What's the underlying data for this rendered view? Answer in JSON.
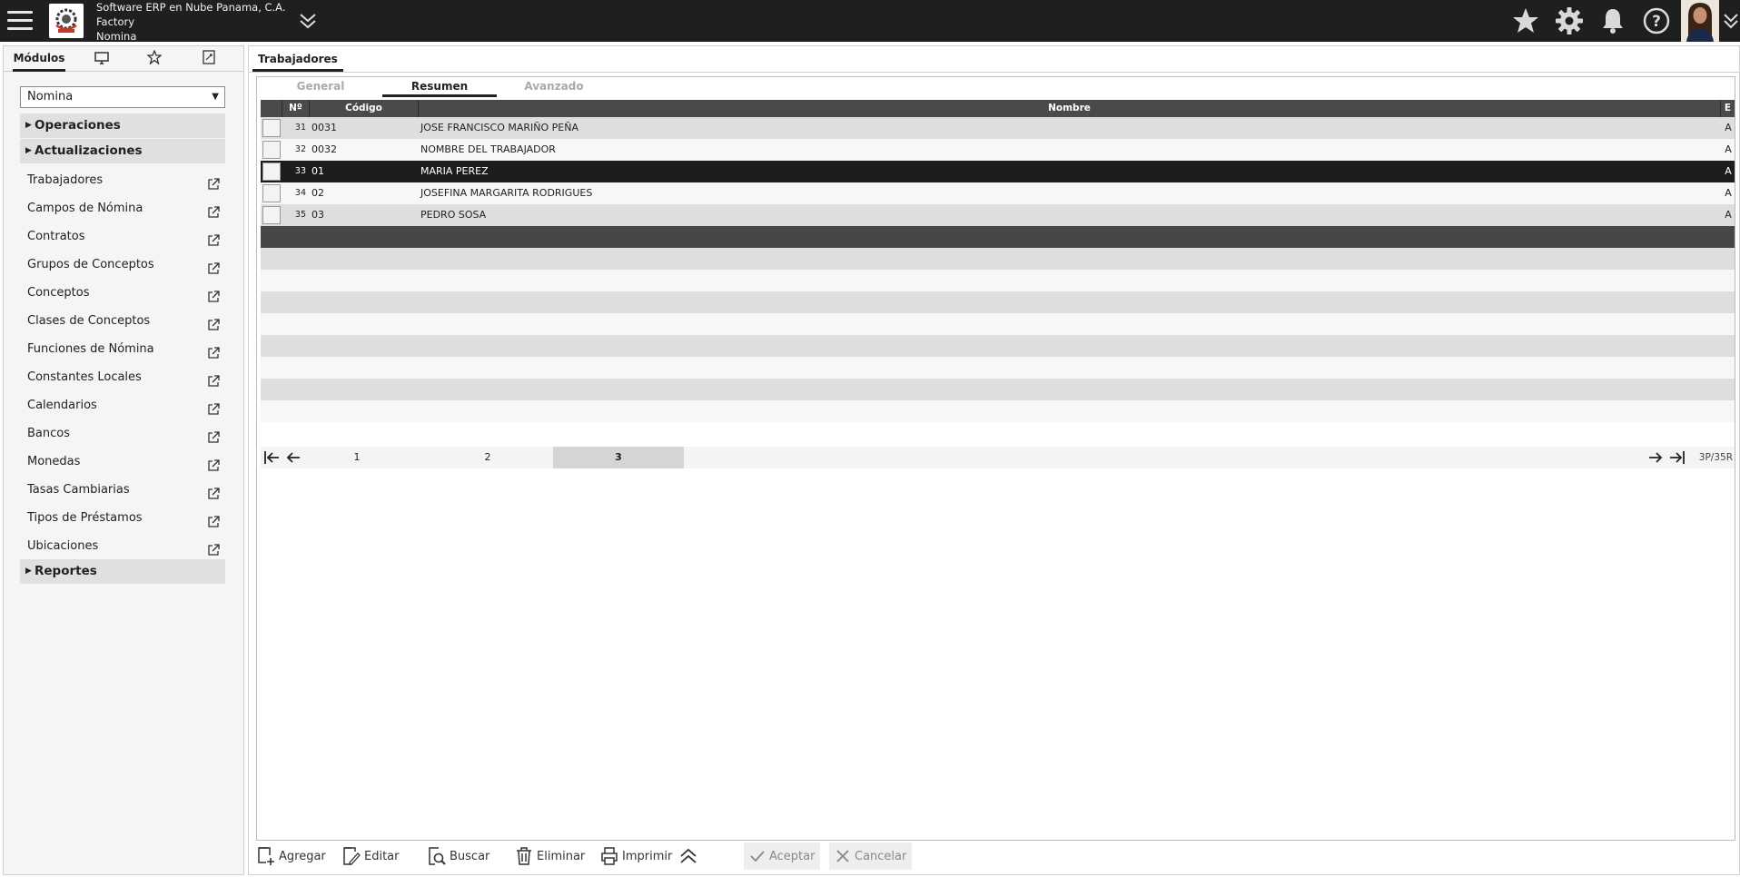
{
  "header": {
    "company_name": "Software ERP en Nube Panama, C.A.",
    "workspace": "Factory",
    "module": "Nomina"
  },
  "sidebar": {
    "tabs": [
      {
        "label": "Módulos",
        "icon": null
      },
      {
        "label": "",
        "icon": "monitor-icon"
      },
      {
        "label": "",
        "icon": "star-outline-icon"
      },
      {
        "label": "",
        "icon": "document-edit-icon"
      }
    ],
    "selected_module": "Nomina",
    "groups": {
      "operaciones": "Operaciones",
      "actualizaciones": "Actualizaciones",
      "reportes": "Reportes"
    },
    "items": [
      "Trabajadores",
      "Campos de Nómina",
      "Contratos",
      "Grupos de Conceptos",
      "Conceptos",
      "Clases de Conceptos",
      "Funciones de Nómina",
      "Constantes Locales",
      "Calendarios",
      "Bancos",
      "Monedas",
      "Tasas Cambiarias",
      "Tipos de Préstamos",
      "Ubicaciones"
    ]
  },
  "main": {
    "tab": "Trabajadores",
    "subtabs": [
      "General",
      "Resumen",
      "Avanzado"
    ],
    "active_subtab": "Resumen",
    "columns": {
      "num": "Nº",
      "code": "Código",
      "name": "Nombre",
      "e": "E"
    },
    "rows": [
      {
        "num": "31",
        "code": "0031",
        "name": "JOSE FRANCISCO MARIÑO PEÑA",
        "e": "A"
      },
      {
        "num": "32",
        "code": "0032",
        "name": "NOMBRE DEL TRABAJADOR",
        "e": "A"
      },
      {
        "num": "33",
        "code": "01",
        "name": "MARIA PEREZ",
        "e": "A"
      },
      {
        "num": "34",
        "code": "02",
        "name": "JOSEFINA MARGARITA RODRIGUES",
        "e": "A"
      },
      {
        "num": "35",
        "code": "03",
        "name": "PEDRO SOSA",
        "e": "A"
      }
    ],
    "selected_row": 2,
    "pager": {
      "pages": [
        "1",
        "2",
        "3"
      ],
      "active_page": "3",
      "count": "3P/35R"
    }
  },
  "toolbar": {
    "add": "Agregar",
    "edit": "Editar",
    "search": "Buscar",
    "delete": "Eliminar",
    "print": "Imprimir",
    "accept": "Aceptar",
    "cancel": "Cancelar"
  },
  "colors": {
    "topbar": "#1f1f1f",
    "selected_row": "#1c1c1c",
    "grid_header": "#4a4a4a"
  }
}
